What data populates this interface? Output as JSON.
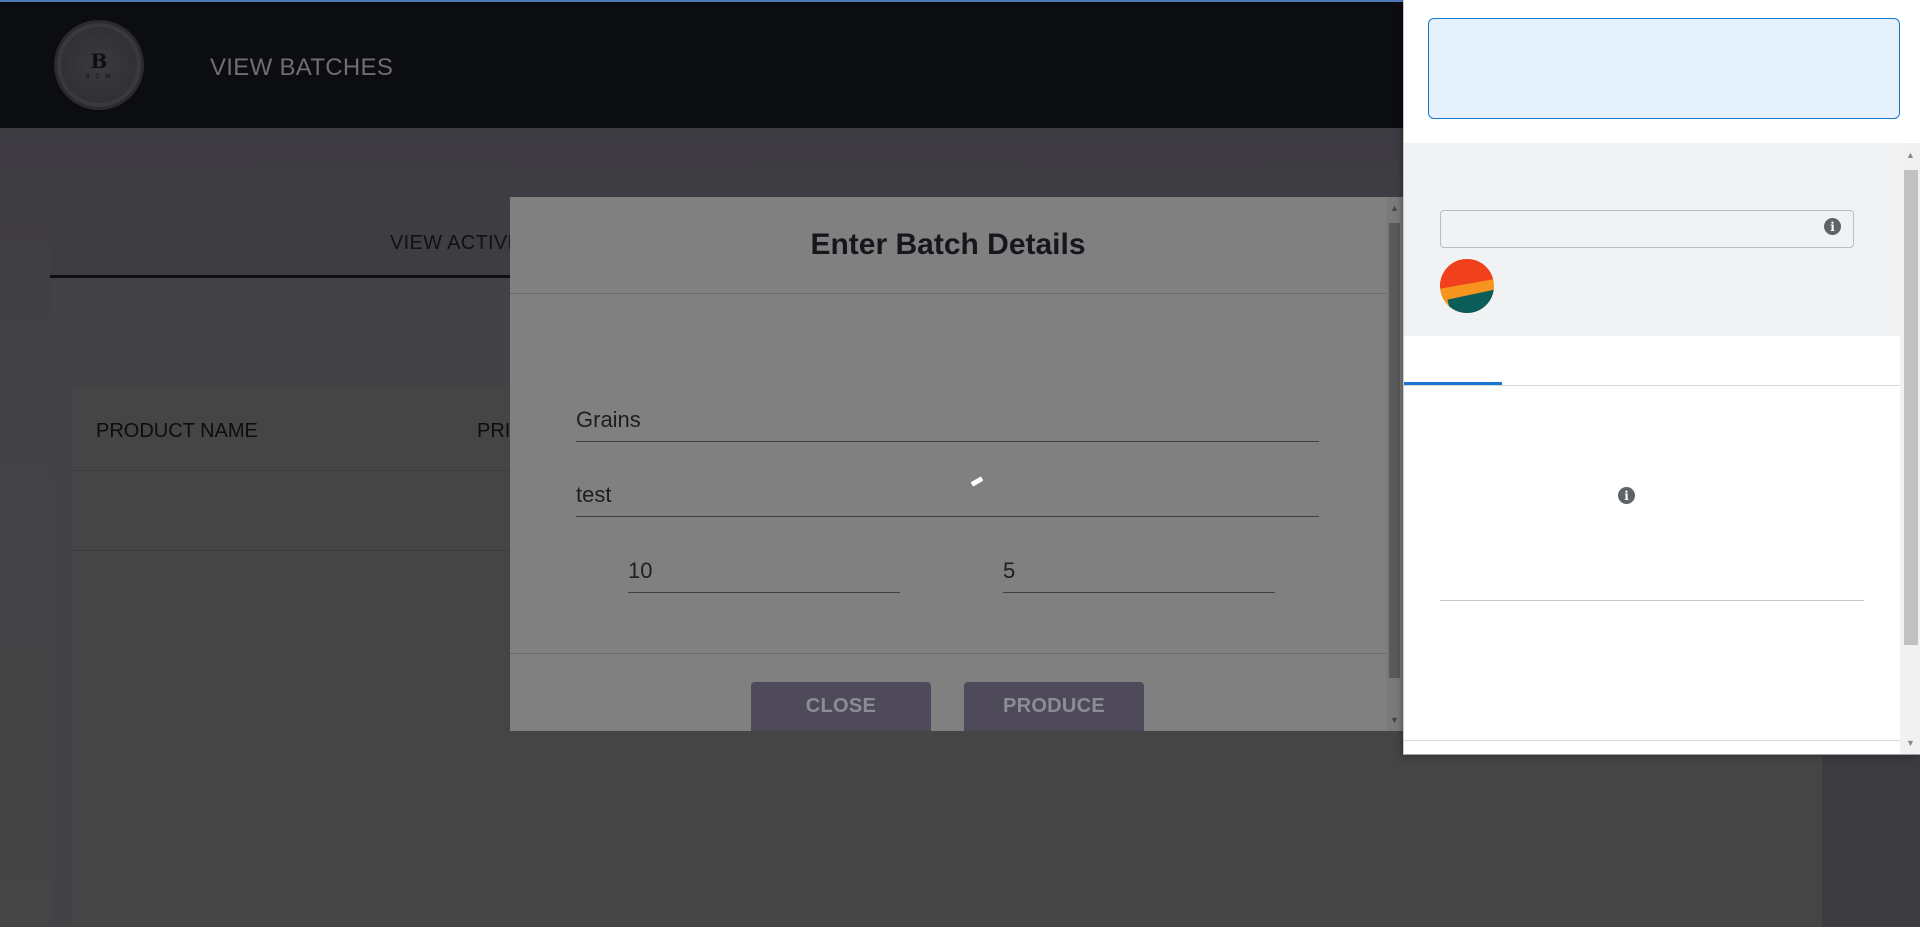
{
  "navbar": {
    "logo_letter": "B",
    "logo_sub": "B C M",
    "link_label": "VIEW BATCHES"
  },
  "tabs": {
    "active_label": "VIEW ACTIVE"
  },
  "table": {
    "headers": [
      "PRODUCT NAME",
      "PRI"
    ]
  },
  "modal": {
    "title": "Enter Batch Details",
    "fields": {
      "product": "Grains",
      "description": "test",
      "quantity": "10",
      "price": "5"
    },
    "buttons": {
      "close": "CLOSE",
      "produce": "PRODUCE"
    }
  },
  "popup": {
    "info_glyph": "i"
  },
  "colors": {
    "accent_blue": "#1a78d4",
    "button_bg": "#4e4a5a",
    "navbar_bg": "#0c0d11"
  }
}
